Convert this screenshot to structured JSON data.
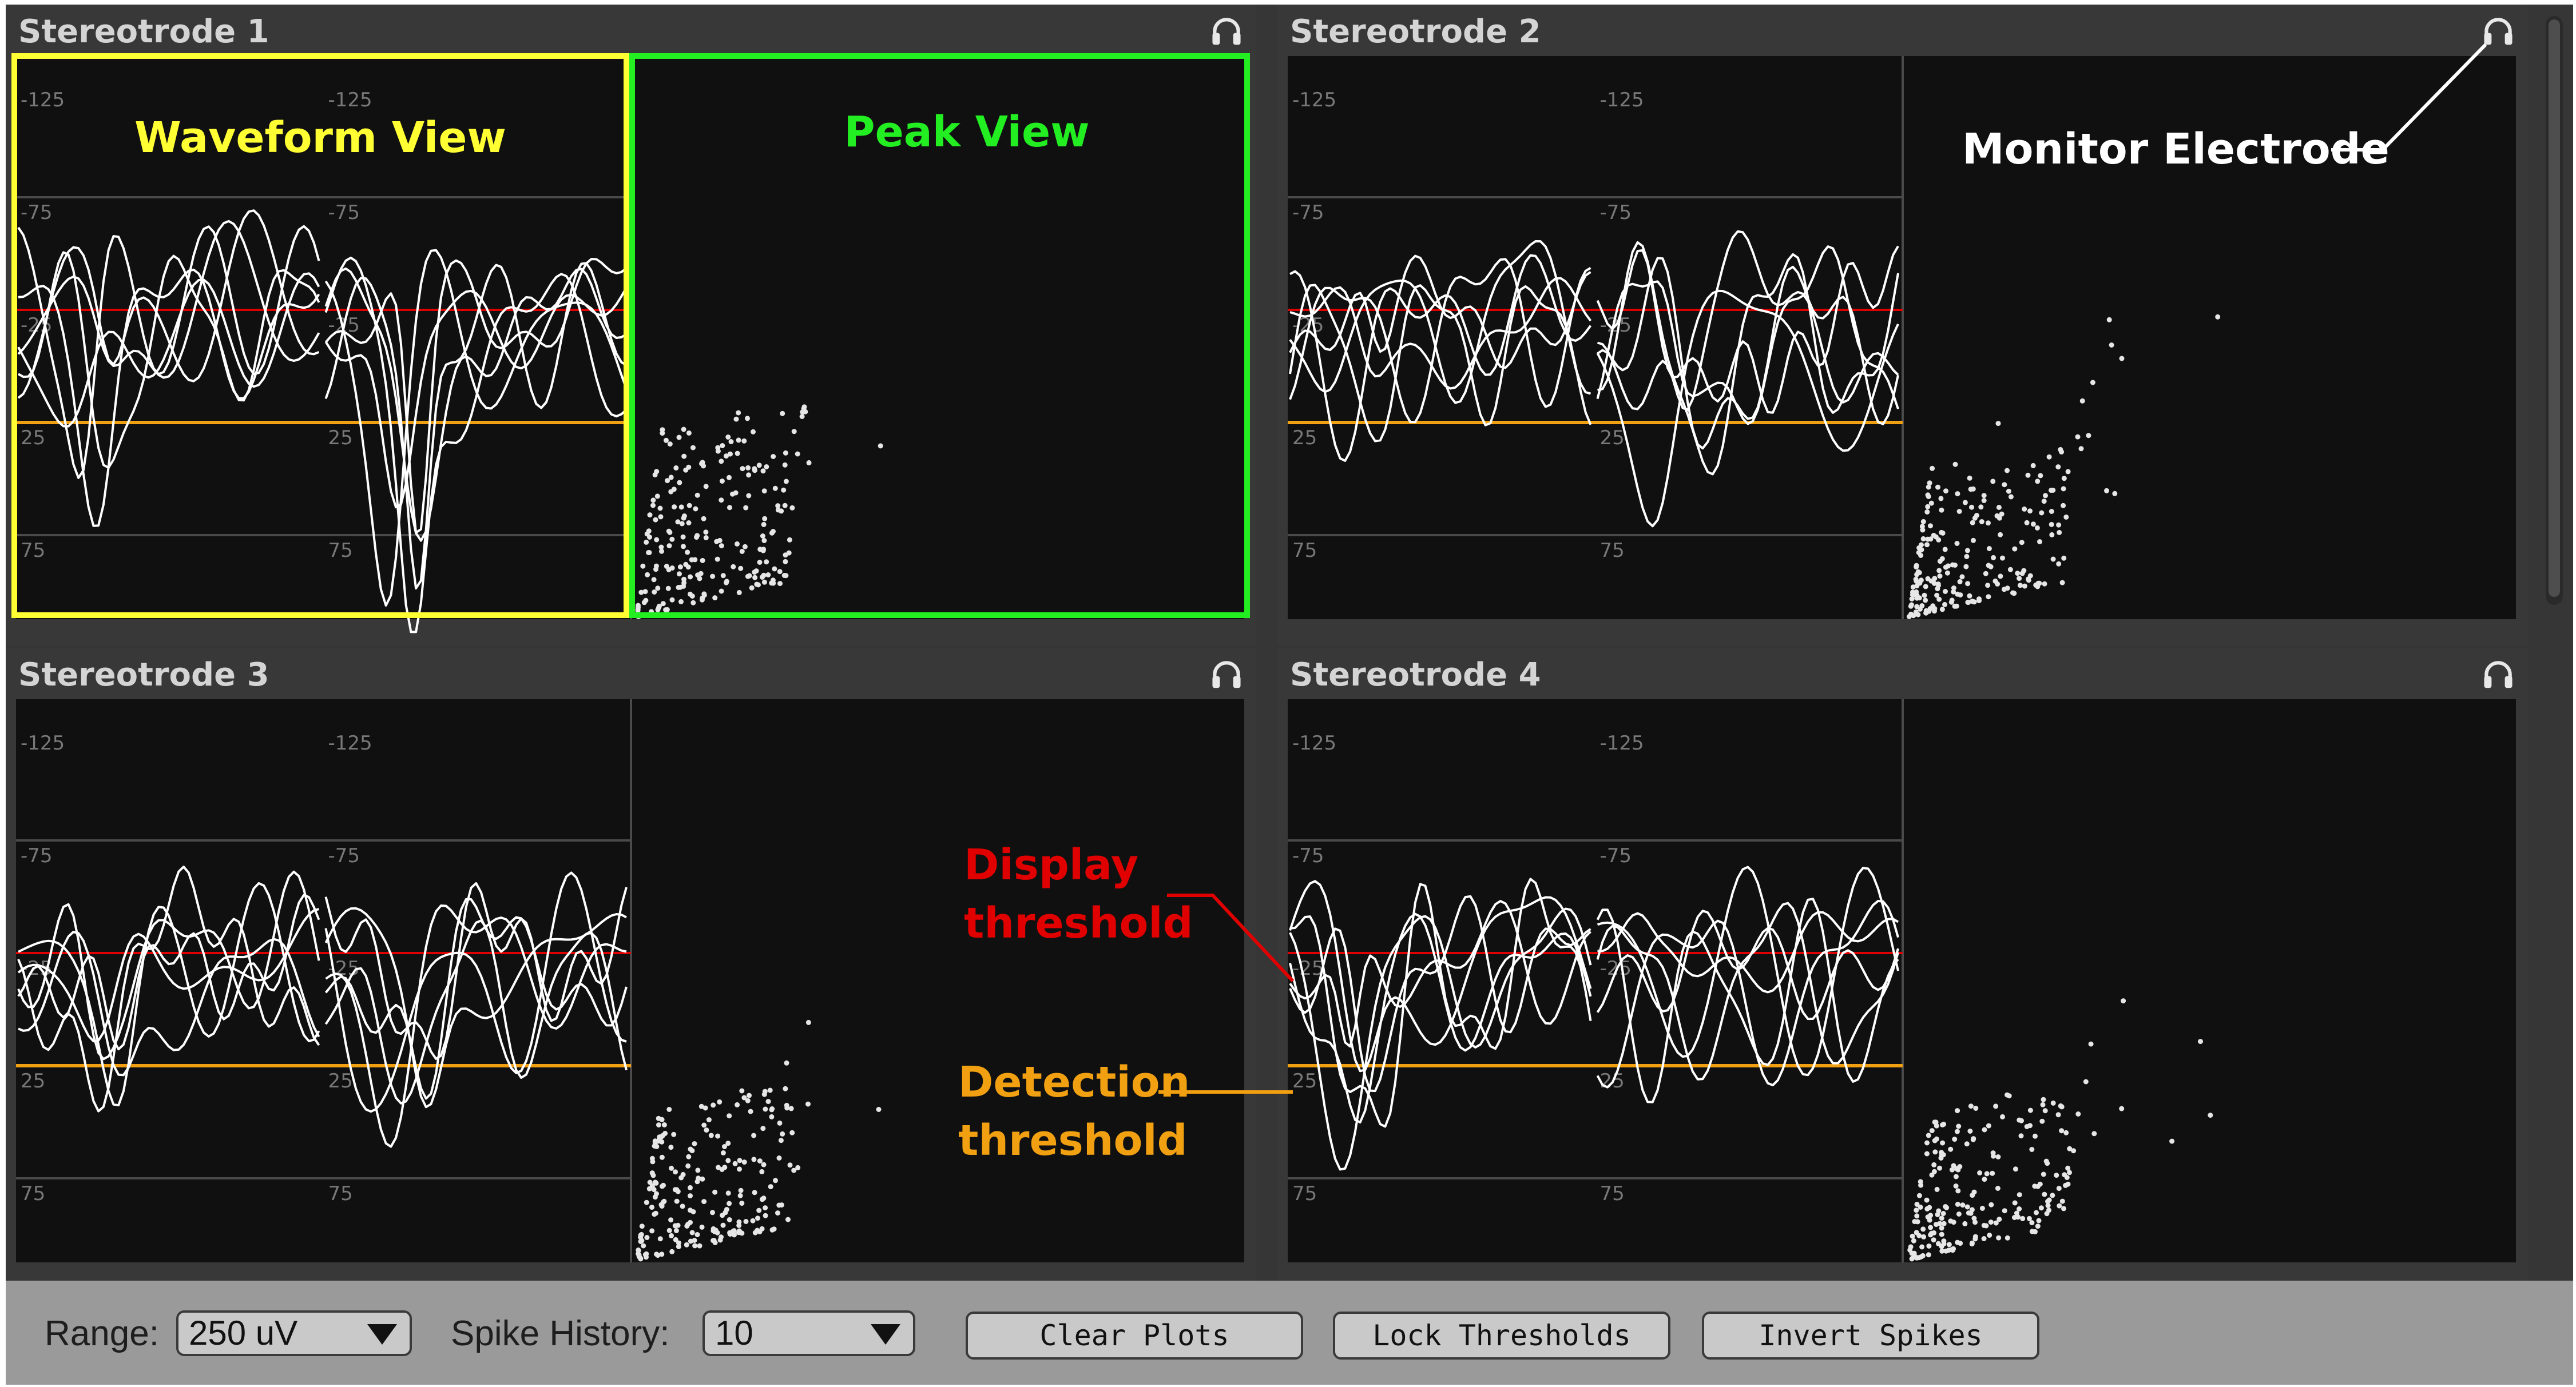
{
  "colors": {
    "background": "#363636",
    "plot_background": "#101010",
    "grid": "#4a4a4a",
    "axis_text": "#787878",
    "waveform": "#ffffff",
    "display_threshold": "#e00000",
    "detection_threshold": "#f0a010",
    "annotation_waveform": "#ffff33",
    "annotation_peak": "#22ee22",
    "annotation_monitor": "#ffffff",
    "toolbar": "#9a9a9a",
    "control": "#c9c9c9"
  },
  "axis_ticks": [
    "-125",
    "-75",
    "-25",
    "25",
    "75"
  ],
  "stereotrodes": [
    {
      "title": "Stereotrode 1",
      "icon": "headphones-icon",
      "display_threshold_uV": -25,
      "detection_threshold_uV": 25,
      "seed": 11,
      "dip_ch1": 0.55,
      "dip_ch2": 0.95,
      "peak_cloud": "tight"
    },
    {
      "title": "Stereotrode 2",
      "icon": "headphones-icon",
      "display_threshold_uV": -25,
      "detection_threshold_uV": 25,
      "seed": 23,
      "dip_ch1": 0.35,
      "dip_ch2": 0.6,
      "peak_cloud": "wide"
    },
    {
      "title": "Stereotrode 3",
      "icon": "headphones-icon",
      "display_threshold_uV": -25,
      "detection_threshold_uV": 25,
      "seed": 37,
      "dip_ch1": 0.55,
      "dip_ch2": 0.55,
      "peak_cloud": "wide"
    },
    {
      "title": "Stereotrode 4",
      "icon": "headphones-icon",
      "display_threshold_uV": -25,
      "detection_threshold_uV": 25,
      "seed": 51,
      "dip_ch1": 0.6,
      "dip_ch2": 0.1,
      "peak_cloud": "wide"
    }
  ],
  "annotations": {
    "waveform_view": "Waveform View",
    "peak_view": "Peak View",
    "monitor_electrode": "Monitor Electrode",
    "display_threshold_line1": "Display",
    "display_threshold_line2": "threshold",
    "detection_threshold_line1": "Detection",
    "detection_threshold_line2": "threshold"
  },
  "toolbar": {
    "range_label": "Range:",
    "range_value": "250 uV",
    "spike_history_label": "Spike History:",
    "spike_history_value": "10",
    "clear_plots": "Clear Plots",
    "lock_thresholds": "Lock Thresholds",
    "invert_spikes": "Invert Spikes"
  }
}
